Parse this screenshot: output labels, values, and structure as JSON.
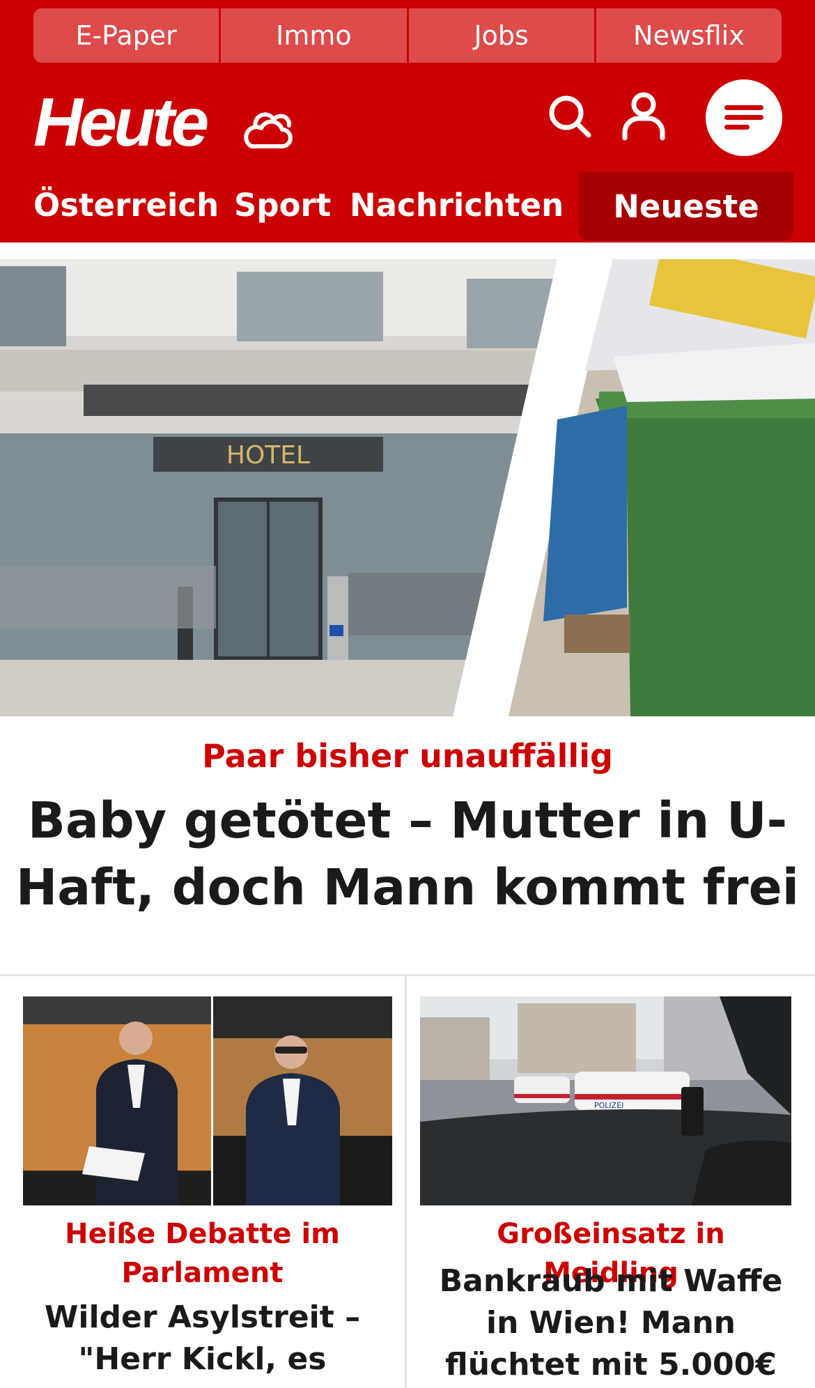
{
  "service_bar": {
    "links": [
      "E-Paper",
      "Immo",
      "Jobs",
      "Newsflix"
    ]
  },
  "header": {
    "logo": "Heute",
    "icons": {
      "weather": "weather-cloud-icon",
      "search": "search-icon",
      "account": "user-icon",
      "menu": "hamburger-menu-icon"
    }
  },
  "nav": {
    "items": [
      "Österreich",
      "Sport",
      "Nachrichten"
    ],
    "active_tab": "Neueste"
  },
  "hero": {
    "image_sign": "HOTEL",
    "kicker": "Paar bisher unauffällig",
    "title": "Baby getötet – Mutter in U-Haft, doch Mann kommt frei"
  },
  "teasers": [
    {
      "kicker": "Heiße Debatte im Parlament",
      "title": "Wilder Asylstreit – \"Herr Kickl, es braucht"
    },
    {
      "kicker": "Großeinsatz in Meidling",
      "title": "Bankraub mit Waffe in Wien! Mann flüchtet mit 5.000€",
      "image_text": "POLIZEI"
    }
  ],
  "colors": {
    "brand_red": "#cc0000",
    "service_link_bg": "#dd4b4b",
    "active_tab_bg": "#a80000",
    "headline": "#1a1a1a"
  }
}
